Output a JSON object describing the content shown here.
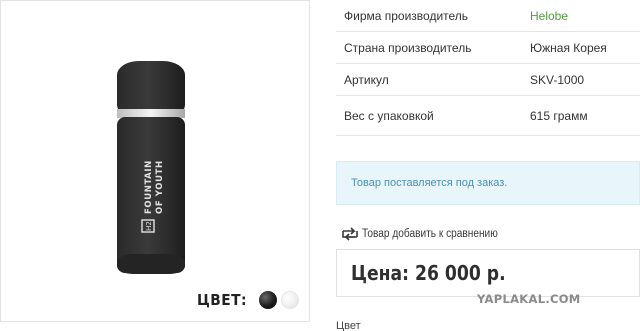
{
  "product": {
    "color_label": "ЦВЕТ:",
    "bottle_text_line1": "FOUNTAIN",
    "bottle_text_line2": "OF YOUTH",
    "swatches": [
      {
        "name": "black",
        "color": "#1b1b1b",
        "selected": true
      },
      {
        "name": "white",
        "color": "#eeeeee",
        "selected": false
      }
    ]
  },
  "specs": [
    {
      "label": "Фирма производитель",
      "value": "Helobe"
    },
    {
      "label": "Страна производитель",
      "value": "Южная Корея"
    },
    {
      "label": "Артикул",
      "value": "SKV-1000"
    },
    {
      "label": "Вес с упаковкой",
      "value": "615 грамм"
    }
  ],
  "notice": "Товар поставляется под заказ.",
  "compare_link": "Товар добавить к сравнению",
  "price": "Цена: 26 000 р.",
  "watermark": "YAPLAKAL.COM",
  "bottom_label": "Цвет",
  "colors": {
    "brand_link": "#4e9c3c",
    "notice_bg": "#e8f5fa",
    "notice_text": "#4a90b5"
  }
}
